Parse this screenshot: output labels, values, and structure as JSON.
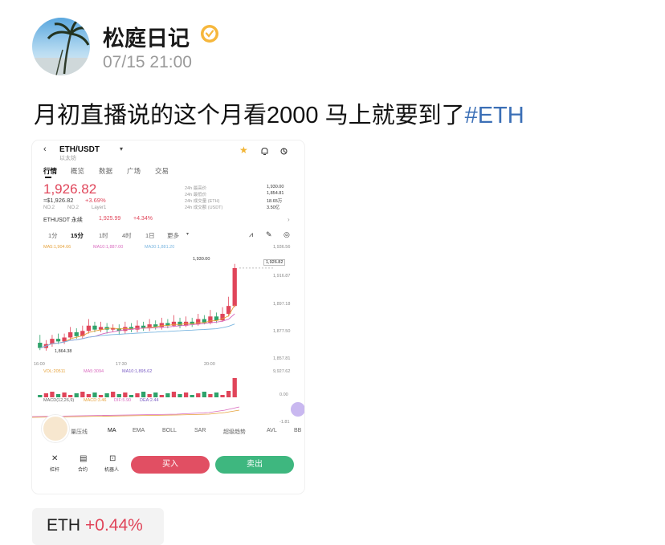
{
  "post": {
    "author": "松庭日记",
    "time": "07/15 21:00",
    "text": "月初直播说的这个月看2000  马上就要到了",
    "hashtag": "#ETH",
    "verified_icon": "verified-badge-icon"
  },
  "chip": {
    "name": "ETH",
    "change": "+0.44%"
  },
  "phone": {
    "pair": "ETH/USDT",
    "subtitle": "以太坊",
    "tabs": [
      "行情",
      "概览",
      "数据",
      "广场",
      "交易"
    ],
    "price": "1,926.82",
    "price_sub": "≈$1,926.82",
    "change": "+3.69%",
    "tags": [
      "NO.2",
      "NO.2",
      "Layer1"
    ],
    "stats": [
      {
        "label": "24h 最高价",
        "value": "1,930.00"
      },
      {
        "label": "24h 最低价",
        "value": "1,854.81"
      },
      {
        "label": "24h 成交量 (ETH)",
        "value": "18.65万"
      },
      {
        "label": "24h 成交额 (USDT)",
        "value": "3.50亿"
      }
    ],
    "perp_label": "ETHUSDT 永续",
    "perp_price": "1,925.99",
    "perp_change": "+4.34%",
    "intervals": [
      "1分",
      "15分",
      "1时",
      "4时",
      "1日",
      "更多"
    ],
    "ma_labels": [
      "MA5:1,904.66",
      "MA10:1,887.00",
      "MA30:1,881.20"
    ],
    "price_axis": [
      "1,936.56",
      "1,926.82",
      "1,916.87",
      "1,897.18",
      "1,877.50",
      "1,857.81"
    ],
    "high_label": "1,930.00",
    "low_label": "1,864.38",
    "time_axis": [
      "16:00",
      "17:30",
      "20:00"
    ],
    "vol_labels": [
      "VOL:20511",
      "MA5:3094",
      "MA10:1,895.62"
    ],
    "vol_axis": "9,927.62",
    "macd_labels": [
      "MACD(12,26,9)",
      "MACD:3.46",
      "DIF:5.90",
      "DEA:2.44"
    ],
    "macd_axis": [
      "0.00",
      "-1.81"
    ],
    "indicators": [
      "量压线",
      "MA",
      "EMA",
      "BOLL",
      "SAR",
      "超级趋势",
      "AVL",
      "BB"
    ],
    "bottom_nav": [
      "杠杆",
      "合约",
      "机器人"
    ],
    "buy_label": "买入",
    "sell_label": "卖出"
  },
  "chart_data": {
    "type": "candlestick",
    "title": "ETH/USDT 15分",
    "candles": [
      [
        1870,
        1866,
        1876,
        1864.38
      ],
      [
        1866,
        1869,
        1872,
        1864
      ],
      [
        1869,
        1873,
        1876,
        1867
      ],
      [
        1873,
        1871,
        1877,
        1869
      ],
      [
        1871,
        1874,
        1877,
        1869
      ],
      [
        1874,
        1878,
        1882,
        1872
      ],
      [
        1878,
        1875,
        1881,
        1873
      ],
      [
        1875,
        1879,
        1883,
        1873
      ],
      [
        1879,
        1883,
        1888,
        1877
      ],
      [
        1883,
        1880,
        1886,
        1878
      ],
      [
        1880,
        1882,
        1886,
        1878
      ],
      [
        1882,
        1880,
        1885,
        1877
      ],
      [
        1880,
        1881,
        1884,
        1878
      ],
      [
        1881,
        1879,
        1884,
        1876
      ],
      [
        1879,
        1882,
        1886,
        1877
      ],
      [
        1882,
        1880,
        1885,
        1878
      ],
      [
        1880,
        1883,
        1887,
        1878
      ],
      [
        1883,
        1881,
        1886,
        1879
      ],
      [
        1881,
        1884,
        1888,
        1879
      ],
      [
        1884,
        1882,
        1887,
        1880
      ],
      [
        1882,
        1885,
        1889,
        1880
      ],
      [
        1885,
        1883,
        1888,
        1881
      ],
      [
        1883,
        1886,
        1891,
        1882
      ],
      [
        1886,
        1883,
        1889,
        1881
      ],
      [
        1883,
        1886,
        1890,
        1882
      ],
      [
        1886,
        1884,
        1889,
        1882
      ],
      [
        1884,
        1888,
        1892,
        1883
      ],
      [
        1888,
        1885,
        1891,
        1884
      ],
      [
        1885,
        1890,
        1895,
        1884
      ],
      [
        1890,
        1887,
        1893,
        1885
      ],
      [
        1887,
        1892,
        1897,
        1886
      ],
      [
        1892,
        1898,
        1905,
        1890
      ],
      [
        1898,
        1926.82,
        1930,
        1897
      ]
    ],
    "ylim": [
      1857.81,
      1936.56
    ]
  }
}
